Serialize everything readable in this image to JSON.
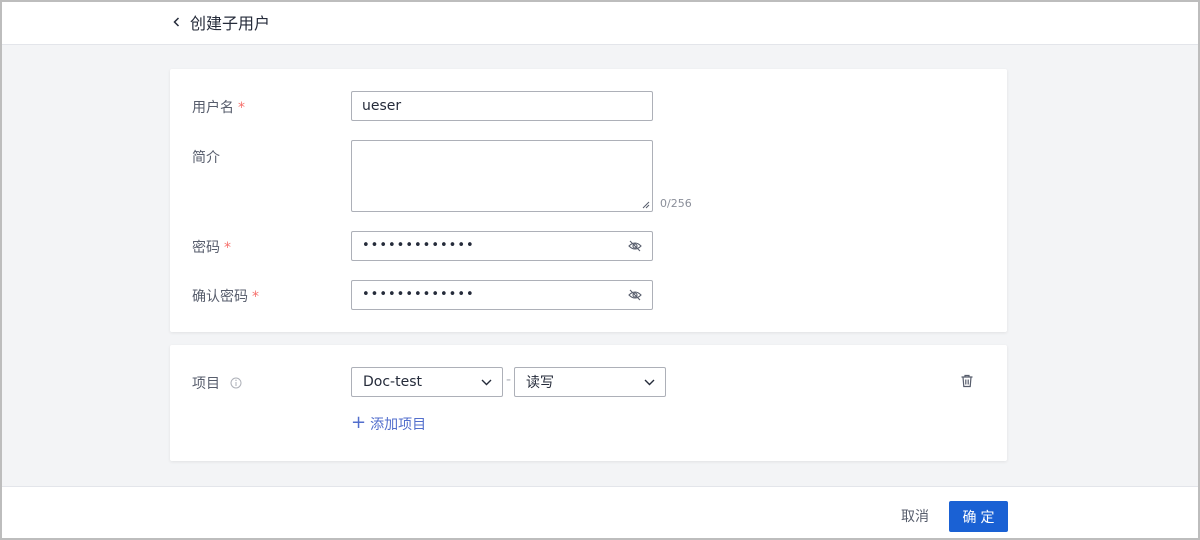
{
  "header": {
    "title": "创建子用户"
  },
  "form": {
    "username": {
      "label": "用户名",
      "required_mark": "*",
      "value": "ueser"
    },
    "description": {
      "label": "简介",
      "value": "",
      "counter": "0/256"
    },
    "password": {
      "label": "密码",
      "required_mark": "*",
      "value": "•••••••••••••"
    },
    "confirm_password": {
      "label": "确认密码",
      "required_mark": "*",
      "value": "•••••••••••••"
    }
  },
  "projects": {
    "label": "项目",
    "rows": [
      {
        "project": "Doc-test",
        "separator": "-",
        "permission": "读写"
      }
    ],
    "add_label": "添加项目",
    "add_icon": "+"
  },
  "footer": {
    "cancel_label": "取消",
    "ok_label": "确定"
  },
  "colors": {
    "primary": "#1a61d4",
    "link": "#526ecc",
    "required": "#f66f6a"
  },
  "icons": {
    "back": "chevron-left-icon",
    "password_toggle": "eye-off-icon",
    "select": "chevron-down-icon",
    "delete": "trash-icon",
    "info": "info-circle-icon"
  }
}
